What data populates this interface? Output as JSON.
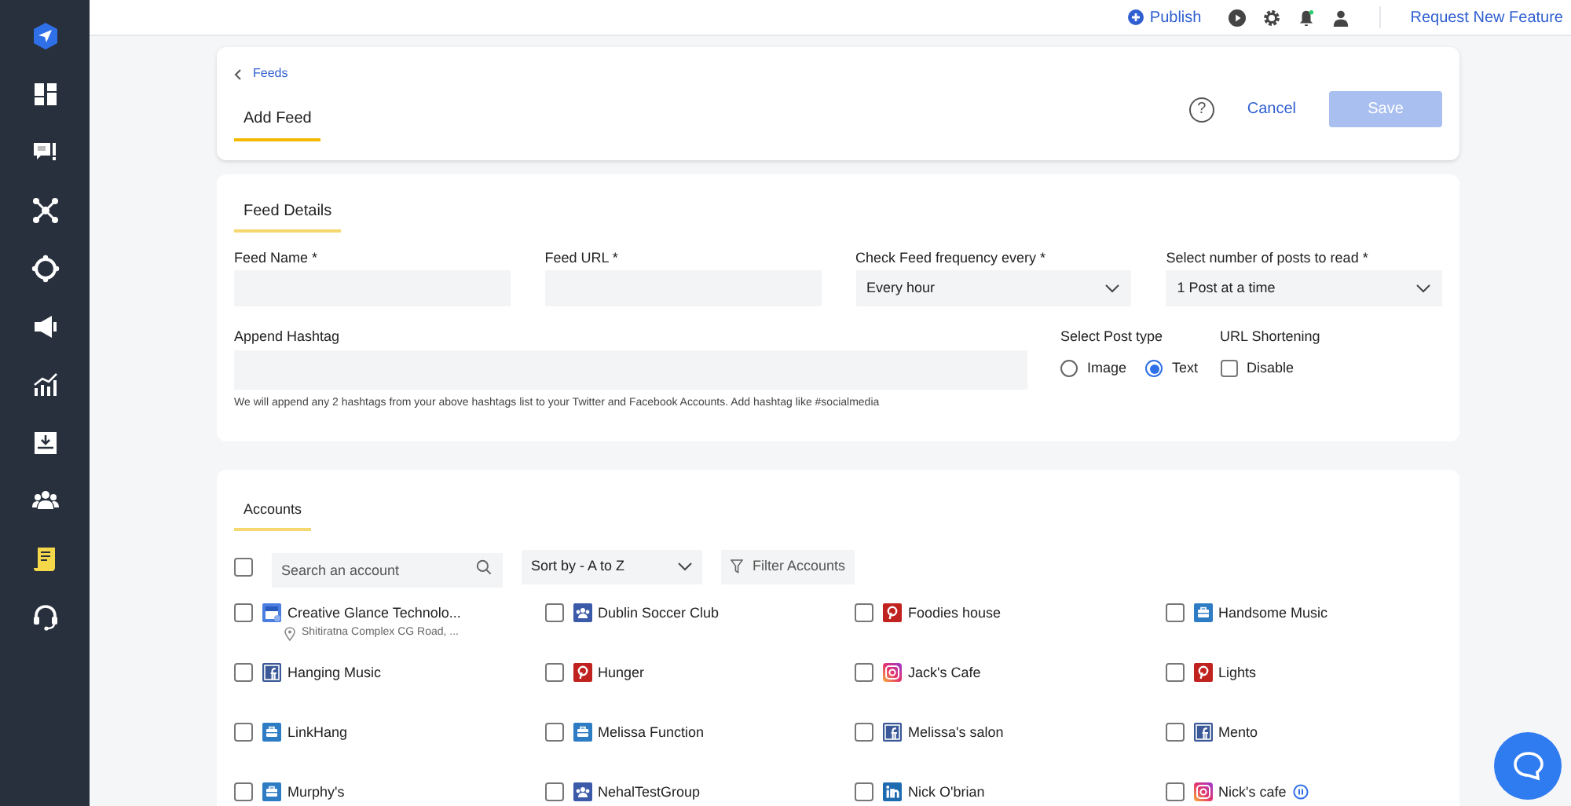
{
  "sidebar": {
    "items": [
      {
        "kind": "logo",
        "selected": false
      },
      {
        "kind": "dashboard",
        "selected": false
      },
      {
        "kind": "chat",
        "selected": false
      },
      {
        "kind": "network",
        "selected": false
      },
      {
        "kind": "target",
        "selected": false
      },
      {
        "kind": "megaphone",
        "selected": false
      },
      {
        "kind": "chart",
        "selected": false
      },
      {
        "kind": "inbox",
        "selected": false
      },
      {
        "kind": "people",
        "selected": false
      },
      {
        "kind": "notes",
        "selected": true
      },
      {
        "kind": "headset",
        "selected": false
      }
    ]
  },
  "top_bar": {
    "publish": "Publish",
    "request_feature": "Request New Feature"
  },
  "header": {
    "breadcrumb": "Feeds",
    "tab": "Add Feed",
    "help": "?",
    "cancel": "Cancel",
    "save": {
      "label": "Save",
      "disabled": true
    }
  },
  "feed_details": {
    "title": "Feed Details",
    "fields": [
      {
        "label": "Feed Name *",
        "kind": "input"
      },
      {
        "label": "Feed URL *",
        "kind": "input"
      },
      {
        "label": "Check Feed frequency every *",
        "kind": "select",
        "value": "Every hour"
      },
      {
        "label": "Select number of posts to read *",
        "kind": "select",
        "value": "1 Post at a time"
      }
    ],
    "hashtag": {
      "label": "Append Hashtag",
      "help": "We will append any 2 hashtags from your above hashtags list to your Twitter and Facebook Accounts. Add hashtag like #socialmedia"
    },
    "post_type": {
      "label": "Select Post type",
      "options": [
        {
          "label": "Image",
          "selected": false
        },
        {
          "label": "Text",
          "selected": true
        }
      ]
    },
    "url_shortening": {
      "label": "URL Shortening",
      "option": {
        "label": "Disable",
        "checked": false
      }
    }
  },
  "accounts": {
    "title": "Accounts",
    "select_all": {
      "checked": false
    },
    "search": {
      "placeholder": "Search an account"
    },
    "sort": "Sort by - A to Z",
    "filter": "Filter Accounts",
    "items": [
      {
        "name": "Creative Glance Technolo...",
        "kind": "business_profile",
        "checked": false,
        "location": "Shitiratna Complex CG Road, ..."
      },
      {
        "name": "Dublin Soccer Club",
        "kind": "group",
        "checked": false
      },
      {
        "name": "Foodies house",
        "kind": "pinterest",
        "checked": false
      },
      {
        "name": "Handsome Music",
        "kind": "page",
        "checked": false
      },
      {
        "name": "Hanging Music",
        "kind": "facebook",
        "checked": false
      },
      {
        "name": "Hunger",
        "kind": "pinterest",
        "checked": false
      },
      {
        "name": "Jack's Cafe",
        "kind": "instagram",
        "checked": false
      },
      {
        "name": "Lights",
        "kind": "pinterest",
        "checked": false
      },
      {
        "name": "LinkHang",
        "kind": "page",
        "checked": false
      },
      {
        "name": "Melissa Function",
        "kind": "page",
        "checked": false
      },
      {
        "name": "Melissa's salon",
        "kind": "facebook",
        "checked": false
      },
      {
        "name": "Mento",
        "kind": "facebook",
        "checked": false
      },
      {
        "name": "Murphy's",
        "kind": "page",
        "checked": false
      },
      {
        "name": "NehalTestGroup",
        "kind": "group",
        "checked": false
      },
      {
        "name": "Nick O'brian",
        "kind": "linkedin",
        "checked": false
      },
      {
        "name": "Nick's cafe",
        "kind": "instagram",
        "checked": false,
        "paused": true
      }
    ]
  }
}
